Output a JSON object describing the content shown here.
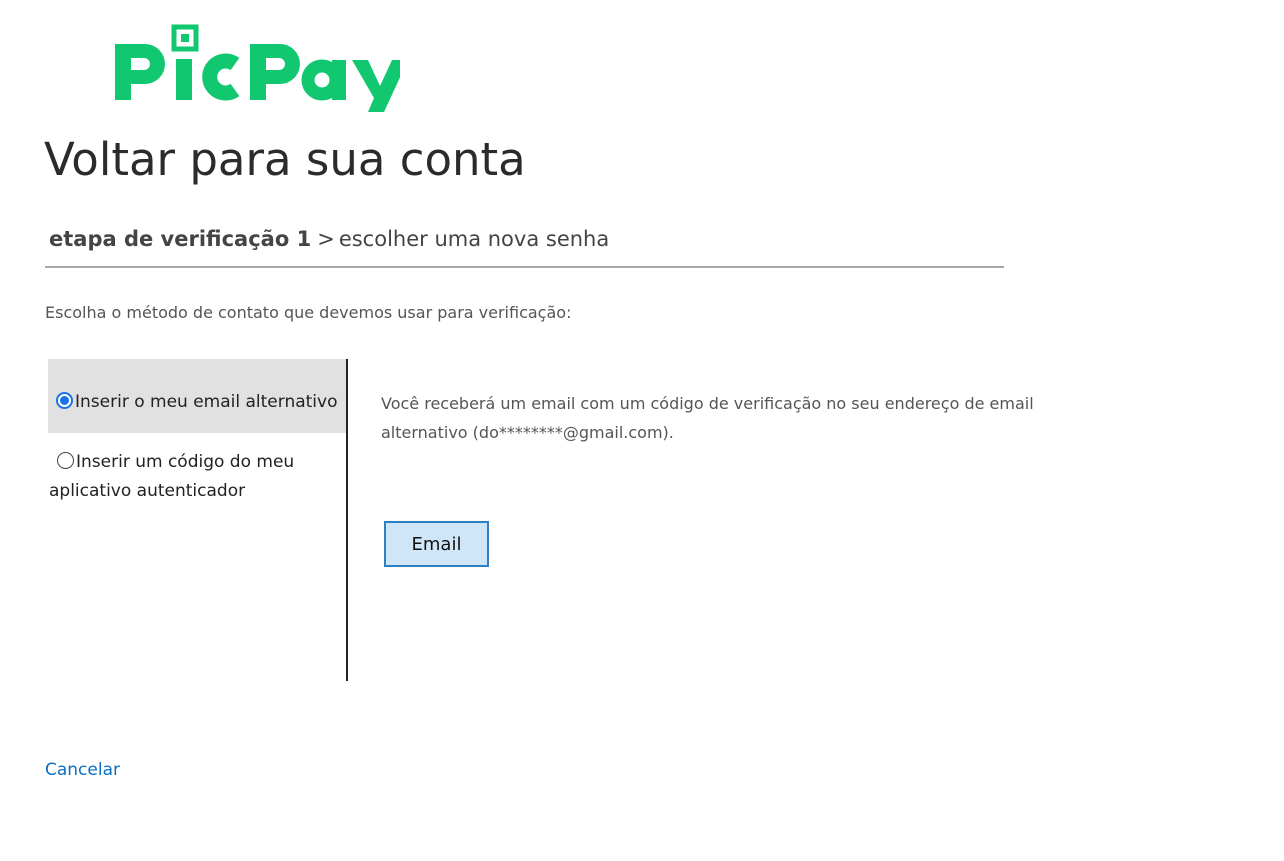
{
  "logo": {
    "text": "PicPay",
    "color": "#11c76f"
  },
  "page_title": "Voltar para sua conta",
  "breadcrumb": {
    "current_step": "etapa de verificação 1",
    "separator": ">",
    "next_step": "escolher uma nova senha"
  },
  "instructions": "Escolha o método de contato que devemos usar para verificação:",
  "methods": [
    {
      "label": "Inserir o meu email alternativo",
      "selected": true
    },
    {
      "label": "Inserir um código do meu aplicativo autenticador",
      "selected": false
    }
  ],
  "method_detail": "Você receberá um email com um código de verificação no seu endereço de email alternativo (do********@gmail.com).",
  "email_button_label": "Email",
  "cancel_label": "Cancelar",
  "colors": {
    "accent_link": "#0b6fc4",
    "button_bg": "#cfe6f8",
    "button_border": "#2f7fc1",
    "selected_row_bg": "#e1e1e1",
    "radio_checked": "#1a73e8"
  }
}
